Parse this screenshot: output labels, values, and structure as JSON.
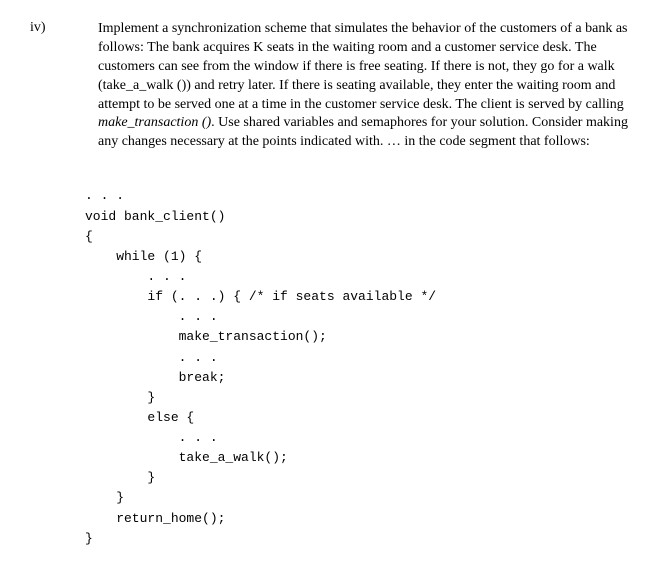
{
  "question": {
    "number": "iv)",
    "text_parts": {
      "p1": "Implement a synchronization scheme that simulates the behavior of the customers of a bank as follows: The bank acquires K seats in the waiting room and a customer service desk. The customers can see from the window if there is free seating. If there is not, they go for a walk (take_a_walk ()) and retry later. If there is seating available, they enter the waiting room and attempt to be served one at a time in the customer service desk. The client is served by calling ",
      "fn": "make_transaction ()",
      "p2": ". Use shared variables and semaphores for your solution. Consider making any changes necessary at the points indicated with.  … in the code segment that follows:"
    }
  },
  "code": {
    "l0": ". . .",
    "l1": "void bank_client()",
    "l2": "{",
    "l3": "    while (1) {",
    "l4": "        . . .",
    "l5": "        if (. . .) { /* if seats available */",
    "l6": "            . . .",
    "l7": "            make_transaction();",
    "l8": "            . . .",
    "l9": "            break;",
    "l10": "        }",
    "l11": "        else {",
    "l12": "            . . .",
    "l13": "            take_a_walk();",
    "l14": "        }",
    "l15": "    }",
    "l16": "    return_home();",
    "l17": "}"
  }
}
